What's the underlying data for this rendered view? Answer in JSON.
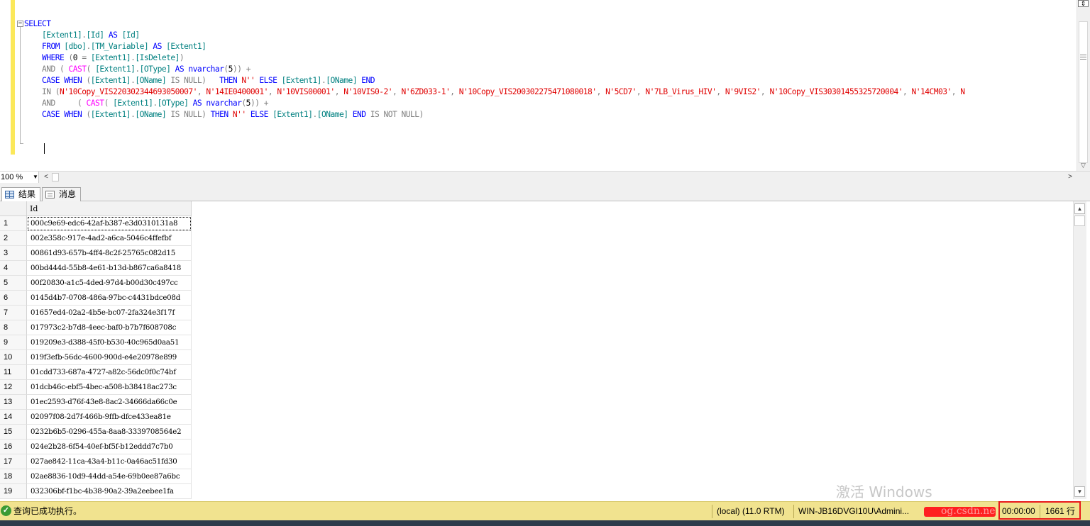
{
  "editor": {
    "fold_symbol": "−",
    "lines": [
      [
        {
          "t": "SELECT",
          "c": "kw"
        }
      ],
      [
        {
          "t": "    "
        },
        {
          "t": "[Extent1]",
          "c": "id"
        },
        {
          "t": ".",
          "c": "gray"
        },
        {
          "t": "[Id]",
          "c": "id"
        },
        {
          "t": " AS ",
          "c": "kw"
        },
        {
          "t": "[Id]",
          "c": "id"
        }
      ],
      [
        {
          "t": "    "
        },
        {
          "t": "FROM ",
          "c": "kw"
        },
        {
          "t": "[dbo]",
          "c": "id"
        },
        {
          "t": ".",
          "c": "gray"
        },
        {
          "t": "[TM_Variable]",
          "c": "id"
        },
        {
          "t": " AS ",
          "c": "kw"
        },
        {
          "t": "[Extent1]",
          "c": "id"
        }
      ],
      [
        {
          "t": "    "
        },
        {
          "t": "WHERE ",
          "c": "kw"
        },
        {
          "t": "(",
          "c": "gray"
        },
        {
          "t": "0 "
        },
        {
          "t": "= ",
          "c": "gray"
        },
        {
          "t": "[Extent1]",
          "c": "id"
        },
        {
          "t": ".",
          "c": "gray"
        },
        {
          "t": "[IsDelete]",
          "c": "id"
        },
        {
          "t": ")",
          "c": "gray"
        }
      ],
      [
        {
          "t": "    "
        },
        {
          "t": "AND ",
          "c": "gray"
        },
        {
          "t": "( ",
          "c": "gray"
        },
        {
          "t": "CAST",
          "c": "fn"
        },
        {
          "t": "( ",
          "c": "gray"
        },
        {
          "t": "[Extent1]",
          "c": "id"
        },
        {
          "t": ".",
          "c": "gray"
        },
        {
          "t": "[OType]",
          "c": "id"
        },
        {
          "t": " AS ",
          "c": "kw"
        },
        {
          "t": "nvarchar",
          "c": "kw"
        },
        {
          "t": "(",
          "c": "gray"
        },
        {
          "t": "5"
        },
        {
          "t": ")) + ",
          "c": "gray"
        }
      ],
      [
        {
          "t": "    "
        },
        {
          "t": "CASE WHEN ",
          "c": "kw"
        },
        {
          "t": "(",
          "c": "gray"
        },
        {
          "t": "[Extent1]",
          "c": "id"
        },
        {
          "t": ".",
          "c": "gray"
        },
        {
          "t": "[OName]",
          "c": "id"
        },
        {
          "t": " IS NULL",
          "c": "gray"
        },
        {
          "t": ")",
          "c": "gray"
        },
        {
          "t": "   THEN ",
          "c": "kw"
        },
        {
          "t": "N''",
          "c": "str"
        },
        {
          "t": " ELSE ",
          "c": "kw"
        },
        {
          "t": "[Extent1]",
          "c": "id"
        },
        {
          "t": ".",
          "c": "gray"
        },
        {
          "t": "[OName]",
          "c": "id"
        },
        {
          "t": " END",
          "c": "kw"
        }
      ],
      [
        {
          "t": "    "
        },
        {
          "t": "IN ",
          "c": "gray"
        },
        {
          "t": "(",
          "c": "gray"
        },
        {
          "t": "N'10Copy_VIS220302344693050007'",
          "c": "str"
        },
        {
          "t": ", ",
          "c": "gray"
        },
        {
          "t": "N'14IE0400001'",
          "c": "str"
        },
        {
          "t": ", ",
          "c": "gray"
        },
        {
          "t": "N'10VIS00001'",
          "c": "str"
        },
        {
          "t": ", ",
          "c": "gray"
        },
        {
          "t": "N'10VIS0-2'",
          "c": "str"
        },
        {
          "t": ", ",
          "c": "gray"
        },
        {
          "t": "N'6ZD033-1'",
          "c": "str"
        },
        {
          "t": ", ",
          "c": "gray"
        },
        {
          "t": "N'10Copy_VIS200302275471080018'",
          "c": "str"
        },
        {
          "t": ", ",
          "c": "gray"
        },
        {
          "t": "N'5CD7'",
          "c": "str"
        },
        {
          "t": ", ",
          "c": "gray"
        },
        {
          "t": "N'7LB_Virus_HIV'",
          "c": "str"
        },
        {
          "t": ", ",
          "c": "gray"
        },
        {
          "t": "N'9VIS2'",
          "c": "str"
        },
        {
          "t": ", ",
          "c": "gray"
        },
        {
          "t": "N'10Copy_VIS30301455325720004'",
          "c": "str"
        },
        {
          "t": ", ",
          "c": "gray"
        },
        {
          "t": "N'14CM03'",
          "c": "str"
        },
        {
          "t": ", ",
          "c": "gray"
        },
        {
          "t": "N",
          "c": "str"
        }
      ],
      [
        {
          "t": "    "
        },
        {
          "t": "AND     ",
          "c": "gray"
        },
        {
          "t": "( ",
          "c": "gray"
        },
        {
          "t": "CAST",
          "c": "fn"
        },
        {
          "t": "( ",
          "c": "gray"
        },
        {
          "t": "[Extent1]",
          "c": "id"
        },
        {
          "t": ".",
          "c": "gray"
        },
        {
          "t": "[OType]",
          "c": "id"
        },
        {
          "t": " AS ",
          "c": "kw"
        },
        {
          "t": "nvarchar",
          "c": "kw"
        },
        {
          "t": "(",
          "c": "gray"
        },
        {
          "t": "5"
        },
        {
          "t": ")) + ",
          "c": "gray"
        }
      ],
      [
        {
          "t": "    "
        },
        {
          "t": "CASE WHEN ",
          "c": "kw"
        },
        {
          "t": "(",
          "c": "gray"
        },
        {
          "t": "[Extent1]",
          "c": "id"
        },
        {
          "t": ".",
          "c": "gray"
        },
        {
          "t": "[OName]",
          "c": "id"
        },
        {
          "t": " IS NULL",
          "c": "gray"
        },
        {
          "t": ") ",
          "c": "gray"
        },
        {
          "t": "THEN ",
          "c": "kw"
        },
        {
          "t": "N''",
          "c": "str"
        },
        {
          "t": " ELSE ",
          "c": "kw"
        },
        {
          "t": "[Extent1]",
          "c": "id"
        },
        {
          "t": ".",
          "c": "gray"
        },
        {
          "t": "[OName]",
          "c": "id"
        },
        {
          "t": " END",
          "c": "kw"
        },
        {
          "t": " IS NOT NULL)",
          "c": "gray"
        }
      ]
    ]
  },
  "zoom": {
    "value": "100 %"
  },
  "tabs": {
    "results": "结果",
    "messages": "消息"
  },
  "grid": {
    "column": "Id",
    "rows": [
      {
        "n": "1",
        "id": "000c9e69-edc6-42af-b387-e3d0310131a8"
      },
      {
        "n": "2",
        "id": "002e358c-917e-4ad2-a6ca-5046c4ffefbf"
      },
      {
        "n": "3",
        "id": "00861d93-657b-4ff4-8c2f-25765c082d15"
      },
      {
        "n": "4",
        "id": "00bd444d-55b8-4e61-b13d-b867ca6a8418"
      },
      {
        "n": "5",
        "id": "00f20830-a1c5-4ded-97d4-b00d30c497cc"
      },
      {
        "n": "6",
        "id": "0145d4b7-0708-486a-97bc-c4431bdce08d"
      },
      {
        "n": "7",
        "id": "01657ed4-02a2-4b5e-bc07-2fa324e3f17f"
      },
      {
        "n": "8",
        "id": "017973c2-b7d8-4eec-baf0-b7b7f608708c"
      },
      {
        "n": "9",
        "id": "019209e3-d388-45f0-b530-40c965d0aa51"
      },
      {
        "n": "10",
        "id": "019f3efb-56dc-4600-900d-e4e20978e899"
      },
      {
        "n": "11",
        "id": "01cdd733-687a-4727-a82c-56dc0f0c74bf"
      },
      {
        "n": "12",
        "id": "01dcb46c-ebf5-4bec-a508-b38418ac273c"
      },
      {
        "n": "13",
        "id": "01ec2593-d76f-43e8-8ac2-34666da66c0e"
      },
      {
        "n": "14",
        "id": "02097f08-2d7f-466b-9ffb-dfce433ea81e"
      },
      {
        "n": "15",
        "id": "0232b6b5-0296-455a-8aa8-3339708564e2"
      },
      {
        "n": "16",
        "id": "024e2b28-6f54-40ef-bf5f-b12eddd7c7b0"
      },
      {
        "n": "17",
        "id": "027ae842-11ca-43a4-b11c-0a46ac51fd30"
      },
      {
        "n": "18",
        "id": "02ae8836-10d9-44dd-a54e-69b0ee87a6bc"
      },
      {
        "n": "19",
        "id": "032306bf-f1bc-4b38-90a2-39a2eebee1fa"
      }
    ]
  },
  "watermark": "激活 Windows",
  "status": {
    "ok_icon": "✓",
    "message": "查询已成功执行。",
    "server": "(local) (11.0 RTM)",
    "user": "WIN-JB16DVGI10U\\Admini...",
    "redacted_text": "og.csdn.ne",
    "time": "00:00:00",
    "rows": "1661 行"
  },
  "colors": {
    "keyword": "#0000ff",
    "identifier": "#008080",
    "string": "#e00000",
    "operator": "#808080",
    "function": "#ff00ff",
    "status_bar": "#f1e38f",
    "change_margin": "#fbe85a",
    "highlight_box": "#e8191b"
  }
}
